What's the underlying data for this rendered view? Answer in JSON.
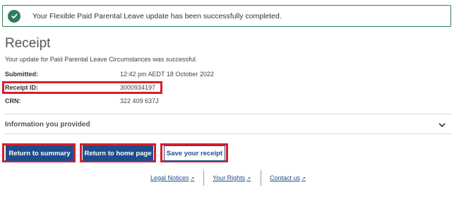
{
  "alert": {
    "message": "Your Flexible Paid Parental Leave update has been successfully completed.",
    "status_color": "#2e7d5b"
  },
  "receipt": {
    "title": "Receipt",
    "subtitle": "Your update for Paid Parental Leave Circumstances was successful.",
    "fields": [
      {
        "label": "Submitted:",
        "value": "12:42 pm AEDT 18 October 2022"
      },
      {
        "label": "Receipt ID:",
        "value": "3000934197"
      },
      {
        "label": "CRN:",
        "value": "322 409 637J"
      }
    ]
  },
  "accordion": {
    "label": "Information you provided",
    "icon": "chevron-down-icon"
  },
  "actions": {
    "return_summary": "Return to summary",
    "return_home": "Return to home page",
    "save_receipt": "Save your receipt"
  },
  "footer": {
    "links": [
      "Legal Notices",
      "Your Rights",
      "Contact us"
    ]
  },
  "colors": {
    "primary": "#1f4d8c",
    "highlight": "#d81e2c"
  }
}
